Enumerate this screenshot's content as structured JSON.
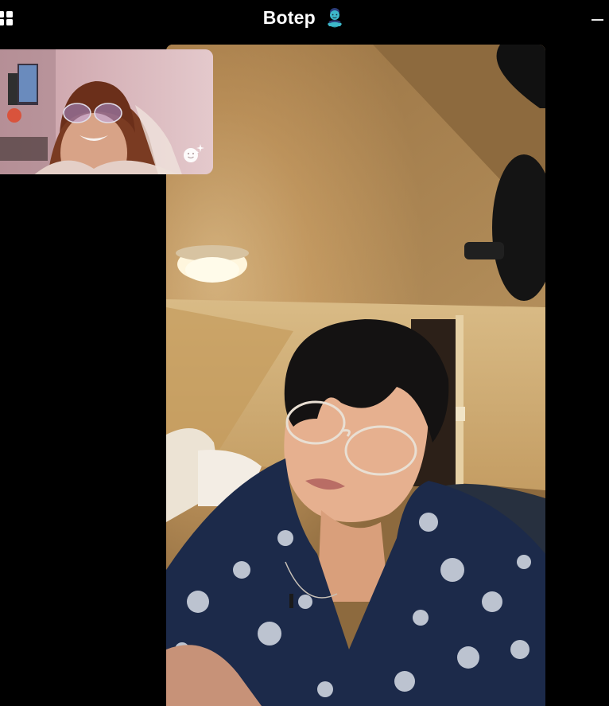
{
  "window": {
    "title": "Botep",
    "title_emoji_icon": "genie-icon",
    "left_button_icon": "grid-layout-icon",
    "right_button_icon": "minimize-icon"
  },
  "remote_video": {
    "icon": "remote-participant-video"
  },
  "self_view": {
    "icon": "self-camera-preview",
    "effects_button_icon": "sparkle-face-effects-icon"
  },
  "colors": {
    "background": "#000000",
    "title_text": "#ffffff"
  }
}
